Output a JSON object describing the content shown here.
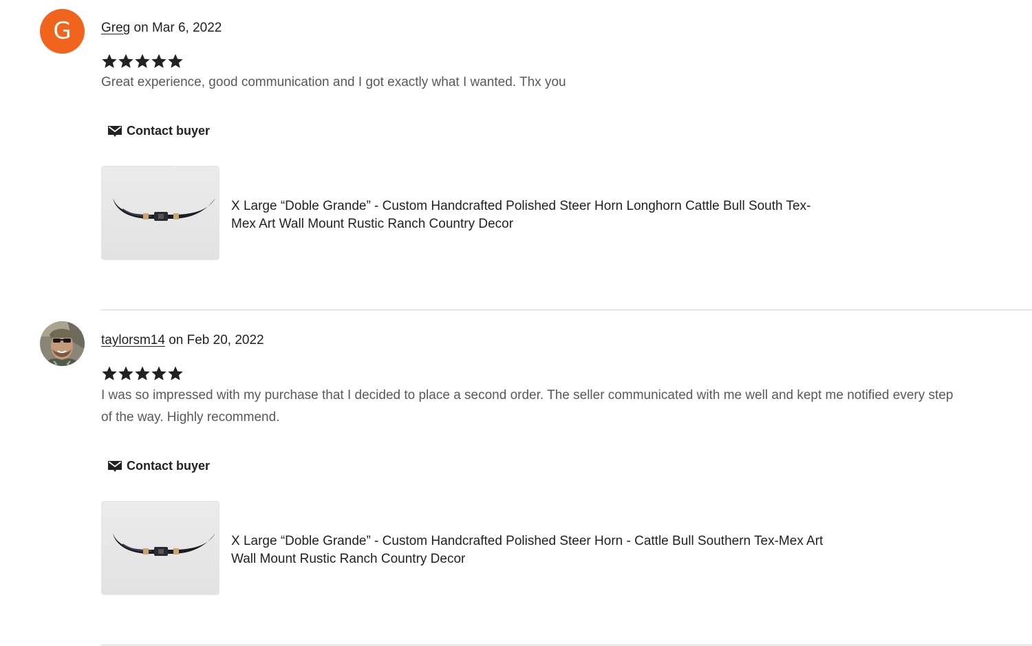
{
  "colors": {
    "avatar_orange": "#f1641e",
    "star": "#222222",
    "text_muted": "#595959",
    "divider": "#d6d6d6"
  },
  "reviews": [
    {
      "avatar_letter": "G",
      "avatar_type": "letter",
      "username": "Greg",
      "date_text": " on Mar 6, 2022",
      "rating": 5,
      "text": "Great experience, good communication and I got exactly what I wanted. Thx you",
      "contact_label": "Contact buyer",
      "contact_icon": "envelope-icon",
      "product_title": "X Large “Doble Grande” - Custom Handcrafted Polished Steer Horn Longhorn Cattle Bull South Tex-Mex Art Wall Mount Rustic Ranch Country Decor",
      "product_image": "steer-horn-thumbnail"
    },
    {
      "avatar_type": "photo",
      "username": "taylorsm14",
      "date_text": " on Feb 20, 2022",
      "rating": 5,
      "text": "I was so impressed with my purchase that I decided to place a second order. The seller communicated with me well and kept me notified every step of the way. Highly recommend.",
      "contact_label": "Contact buyer",
      "contact_icon": "envelope-icon",
      "product_title": "X Large “Doble Grande” - Custom Handcrafted Polished Steer Horn - Cattle Bull Southern Tex-Mex Art Wall Mount Rustic Ranch Country Decor",
      "product_image": "steer-horn-thumbnail"
    }
  ]
}
